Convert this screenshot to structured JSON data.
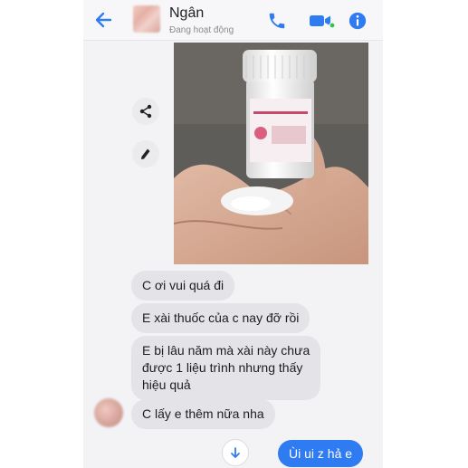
{
  "header": {
    "contact_name": "Ngân",
    "status": "Đang hoạt động"
  },
  "messages": [
    {
      "text": "C ơi vui quá đi"
    },
    {
      "text": "E xài thuốc của c nay đỡ rồi"
    },
    {
      "text": "E bị lâu năm mà xài này chưa\nđược 1 liệu trình nhưng thấy\nhiệu quả"
    },
    {
      "text": "C lấy e thêm nữa nha"
    }
  ],
  "outgoing": {
    "text": "Ùi ui z hả e"
  },
  "colors": {
    "accent": "#2f7bf2",
    "incoming_bubble": "#e4e4e8",
    "background": "#f3f3f6"
  },
  "icons": [
    "back-arrow-icon",
    "phone-icon",
    "video-icon",
    "info-icon",
    "share-icon",
    "edit-icon",
    "arrow-down-icon"
  ]
}
